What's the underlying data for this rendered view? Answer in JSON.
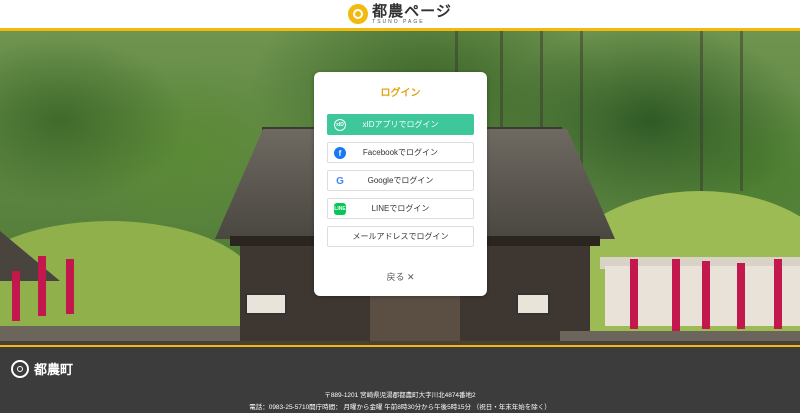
{
  "header": {
    "logo_title": "都農ページ",
    "logo_subtitle": "TSUNO PAGE"
  },
  "modal": {
    "title": "ログイン",
    "buttons": [
      {
        "label": "xIDアプリでログイン",
        "icon": "xid-icon",
        "icon_text": "xID"
      },
      {
        "label": "Facebookでログイン",
        "icon": "facebook-icon",
        "icon_text": "f"
      },
      {
        "label": "Googleでログイン",
        "icon": "google-icon",
        "icon_text": "G"
      },
      {
        "label": "LINEでログイン",
        "icon": "line-icon",
        "icon_text": "LINE"
      },
      {
        "label": "メールアドレスでログイン"
      }
    ],
    "back_label": "戻る",
    "back_symbol": "✕"
  },
  "footer": {
    "name": "都農町",
    "address": "〒889-1201 宮崎県児湯郡都農町大字川北4874番地2",
    "phone_hours": "電話：0983-25-5710開庁時間： 月曜から金曜 午前8時30分から午後5時15分 （祝日・年末年始を除く）"
  },
  "colors": {
    "accent": "#f2b90f",
    "xid_button": "#3dc79a",
    "title": "#e0a514",
    "footer_bg": "#3c3c3c"
  }
}
